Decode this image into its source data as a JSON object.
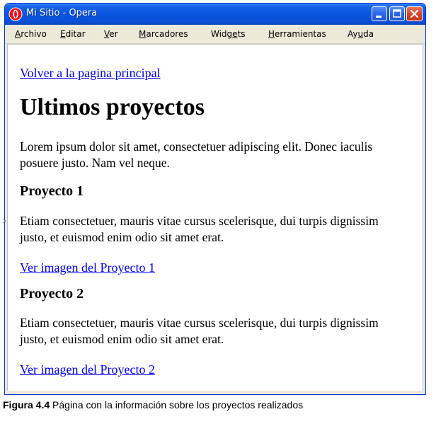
{
  "window": {
    "title": "Mi Sitio - Opera"
  },
  "menu": {
    "items": [
      {
        "accel": "A",
        "rest": "rchivo"
      },
      {
        "accel": "E",
        "rest": "ditar"
      },
      {
        "accel": "V",
        "rest": "er"
      },
      {
        "accel": "M",
        "rest": "arcadores"
      },
      {
        "pre": "Widg",
        "accel": "e",
        "rest": "ts"
      },
      {
        "accel": "H",
        "rest": "erramientas"
      },
      {
        "pre": "Ay",
        "accel": "u",
        "rest": "da"
      }
    ]
  },
  "page": {
    "back_link": "Volver a la pagina principal",
    "title": "Ultimos proyectos",
    "intro": "Lorem ipsum dolor sit amet, consectetuer adipiscing elit. Donec iaculis posuere justo. Nam vel neque.",
    "projects": [
      {
        "heading": "Proyecto 1",
        "text": "Etiam consectetuer, mauris vitae cursus scelerisque, dui turpis dignissim justo, et euismod enim odio sit amet erat.",
        "link": "Ver imagen del Proyecto 1"
      },
      {
        "heading": "Proyecto 2",
        "text": "Etiam consectetuer, mauris vitae cursus scelerisque, dui turpis dignissim justo, et euismod enim odio sit amet erat.",
        "link": "Ver imagen del Proyecto 2"
      }
    ]
  },
  "caption": {
    "label": "Figura 4.4",
    "text": " Página con la información sobre los proyectos realizados"
  },
  "colors": {
    "titlebar": "#0a55df",
    "link": "#0000ee",
    "chrome": "#ece9d8",
    "close_button": "#d8452a"
  },
  "icons": {
    "app": "opera-logo-icon",
    "minimize": "minimize-icon",
    "maximize": "maximize-icon",
    "close": "close-icon"
  }
}
